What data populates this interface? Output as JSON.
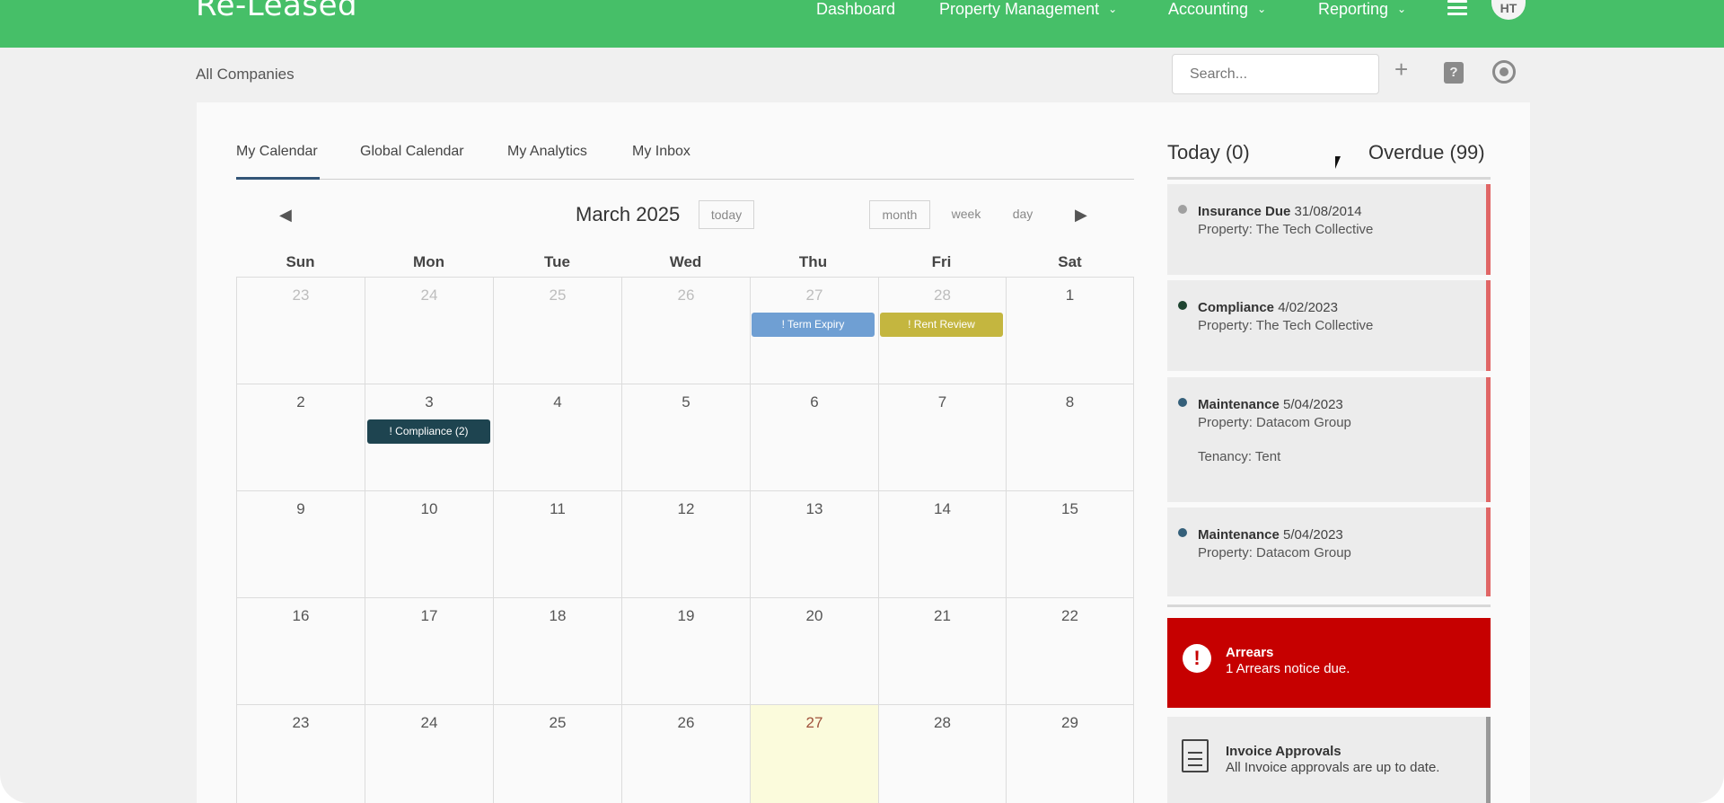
{
  "app": {
    "logo": "Re-Leased"
  },
  "nav": {
    "items": [
      {
        "label": "Dashboard"
      },
      {
        "label": "Property Management"
      },
      {
        "label": "Accounting"
      },
      {
        "label": "Reporting"
      }
    ],
    "avatar_initials": "HT"
  },
  "subbar": {
    "breadcrumb": "All Companies",
    "search_placeholder": "Search..."
  },
  "tabs": [
    "My Calendar",
    "Global Calendar",
    "My Analytics",
    "My Inbox"
  ],
  "calendar": {
    "title": "March 2025",
    "today_label": "today",
    "views": [
      "month",
      "week",
      "day"
    ],
    "weekdays": [
      "Sun",
      "Mon",
      "Tue",
      "Wed",
      "Thu",
      "Fri",
      "Sat"
    ],
    "weeks": [
      [
        "23",
        "24",
        "25",
        "26",
        "27",
        "28",
        "1"
      ],
      [
        "2",
        "3",
        "4",
        "5",
        "6",
        "7",
        "8"
      ],
      [
        "9",
        "10",
        "11",
        "12",
        "13",
        "14",
        "15"
      ],
      [
        "16",
        "17",
        "18",
        "19",
        "20",
        "21",
        "22"
      ],
      [
        "23",
        "24",
        "25",
        "26",
        "27",
        "28",
        "29"
      ]
    ],
    "events": [
      {
        "label": "! Term Expiry",
        "color": "#6f9fd3"
      },
      {
        "label": "! Rent Review",
        "color": "#c4b63f"
      },
      {
        "label": "! Compliance (2)",
        "color": "#1e4450"
      }
    ]
  },
  "sidebar": {
    "today_label": "Today (0)",
    "overdue_label": "Overdue (99)",
    "items": [
      {
        "type": "Insurance Due",
        "date": "31/08/2014",
        "property": "Property: The Tech Collective",
        "dot": "#a0a0a0"
      },
      {
        "type": "Compliance",
        "date": "4/02/2023",
        "property": "Property: The Tech Collective",
        "dot": "#1e4430"
      },
      {
        "type": "Maintenance",
        "date": "5/04/2023",
        "property": "Property: Datacom Group",
        "extra": "Tenancy: Tent",
        "dot": "#35607a"
      },
      {
        "type": "Maintenance",
        "date": "5/04/2023",
        "property": "Property: Datacom Group",
        "dot": "#35607a"
      }
    ],
    "arrears": {
      "title": "Arrears",
      "text": "1 Arrears notice due."
    },
    "invoice": {
      "title": "Invoice Approvals",
      "text": "All Invoice approvals are up to date."
    }
  },
  "colors": {
    "brand": "#46bf68",
    "alert": "#c60000",
    "overdue_edge": "#e06666"
  }
}
